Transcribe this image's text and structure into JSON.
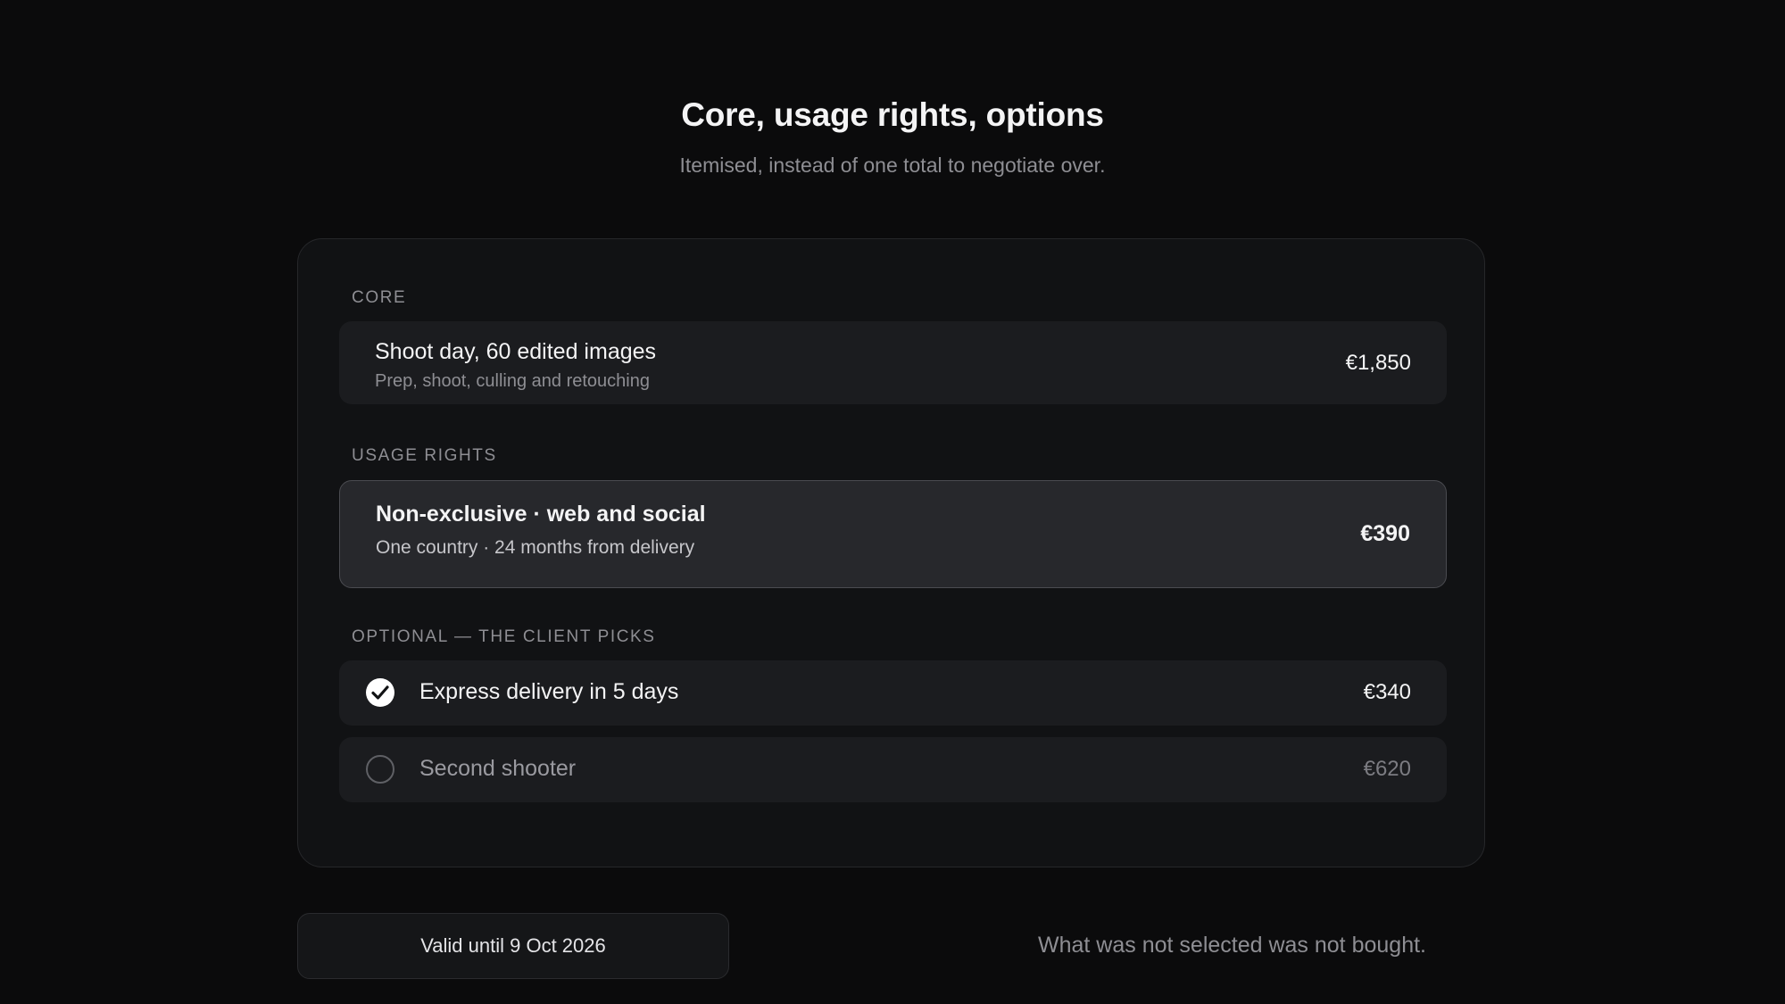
{
  "header": {
    "title": "Core, usage rights, options",
    "subtitle": "Itemised, instead of one total to negotiate over."
  },
  "sections": {
    "core": {
      "label": "CORE",
      "item": {
        "title": "Shoot day, 60 edited images",
        "subtitle": "Prep, shoot, culling and retouching",
        "price": "€1,850"
      }
    },
    "usage": {
      "label": "USAGE RIGHTS",
      "item": {
        "title": "Non-exclusive · web and social",
        "subtitle": "One country · 24 months from delivery",
        "price": "€390",
        "selected": true
      }
    },
    "optional": {
      "label": "OPTIONAL — THE CLIENT PICKS",
      "items": [
        {
          "label": "Express delivery in 5 days",
          "price": "€340",
          "checked": true,
          "icon": "check-circle-icon"
        },
        {
          "label": "Second shooter",
          "price": "€620",
          "checked": false,
          "icon": "radio-empty-icon"
        }
      ]
    }
  },
  "footer": {
    "valid_until": "Valid until 9 Oct 2026",
    "note": "What was not selected was not bought."
  },
  "colors": {
    "background": "#0b0b0c",
    "card": "#111214",
    "row": "#1b1c1f",
    "row_selected": "#27282c",
    "muted_text": "#8e8e93"
  }
}
